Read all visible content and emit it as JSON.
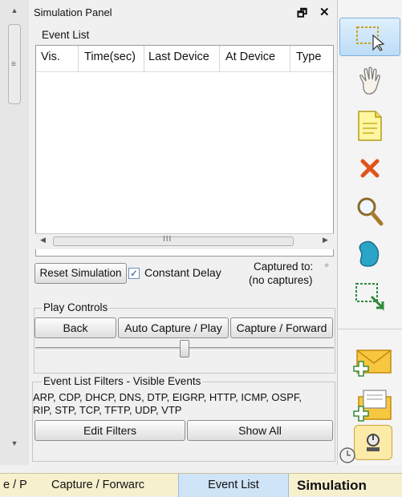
{
  "panel": {
    "title": "Simulation Panel",
    "restore_glyph": "🗗",
    "close_glyph": "✕"
  },
  "event_list": {
    "group_label": "Event List",
    "columns": [
      "Vis.",
      "Time(sec)",
      "Last Device",
      "At Device",
      "Type"
    ],
    "rows": [],
    "hscroll_grip": "III"
  },
  "controls": {
    "reset_label": "Reset Simulation",
    "constant_delay_label": "Constant Delay",
    "constant_delay_checked": true,
    "check_glyph": "✓",
    "captured_label": "Captured to:",
    "captured_value": "(no captures)",
    "captured_marker": "*"
  },
  "play_controls": {
    "group_label": "Play Controls",
    "back_label": "Back",
    "auto_capture_label": "Auto Capture / Play",
    "capture_forward_label": "Capture / Forward",
    "slider_value": 0.5
  },
  "filters": {
    "group_label": "Event List Filters - Visible Events",
    "events_line1": "ARP, CDP, DHCP, DNS, DTP, EIGRP, HTTP, ICMP, OSPF,",
    "events_line2": "RIP, STP, TCP, TFTP, UDP, VTP",
    "edit_label": "Edit Filters",
    "show_all_label": "Show All"
  },
  "scroll": {
    "up_glyph": "▲",
    "down_glyph": "▼",
    "left_glyph": "◀",
    "right_glyph": "▶",
    "grip_glyph": "≡"
  },
  "toolbar": {
    "tools": [
      {
        "icon": "select-icon",
        "active": true
      },
      {
        "icon": "hand-icon"
      },
      {
        "icon": "note-icon"
      },
      {
        "icon": "delete-icon",
        "color": "#e0541b"
      },
      {
        "icon": "zoom-icon"
      },
      {
        "icon": "draw-shape-icon",
        "color": "#2aa5c8"
      },
      {
        "icon": "resize-icon"
      },
      {
        "icon": "add-simple-pdu-icon"
      },
      {
        "icon": "add-complex-pdu-icon"
      },
      {
        "icon": "simulation-mode-icon"
      }
    ]
  },
  "tabs": {
    "left_partial": "e / P",
    "capture_forward": "Capture / Forwarc",
    "event_list": "Event List",
    "simulation": "Simulation"
  },
  "colors": {
    "tabbar": "#f7f0cf",
    "active_tab": "#cfe4f7",
    "accent": "#2a6fb8"
  }
}
